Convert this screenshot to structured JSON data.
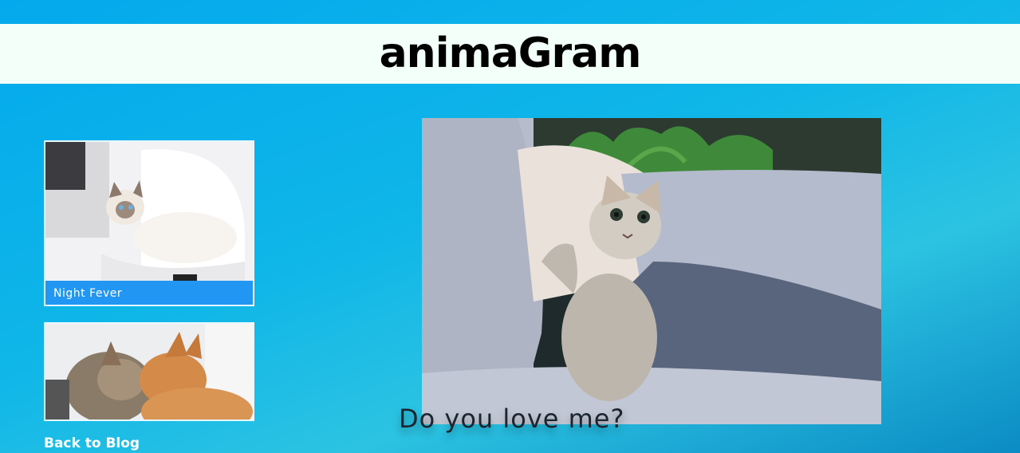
{
  "header": {
    "brand": "animaGram"
  },
  "sidebar": {
    "cards": [
      {
        "caption": "Night Fever"
      },
      {
        "caption": ""
      }
    ],
    "back_link": "Back to Blog"
  },
  "main": {
    "caption": "Do you love me?"
  },
  "colors": {
    "background_top": "#03a9ec",
    "header_bg": "#f3fff9",
    "caption_bar": "#2196f3"
  }
}
